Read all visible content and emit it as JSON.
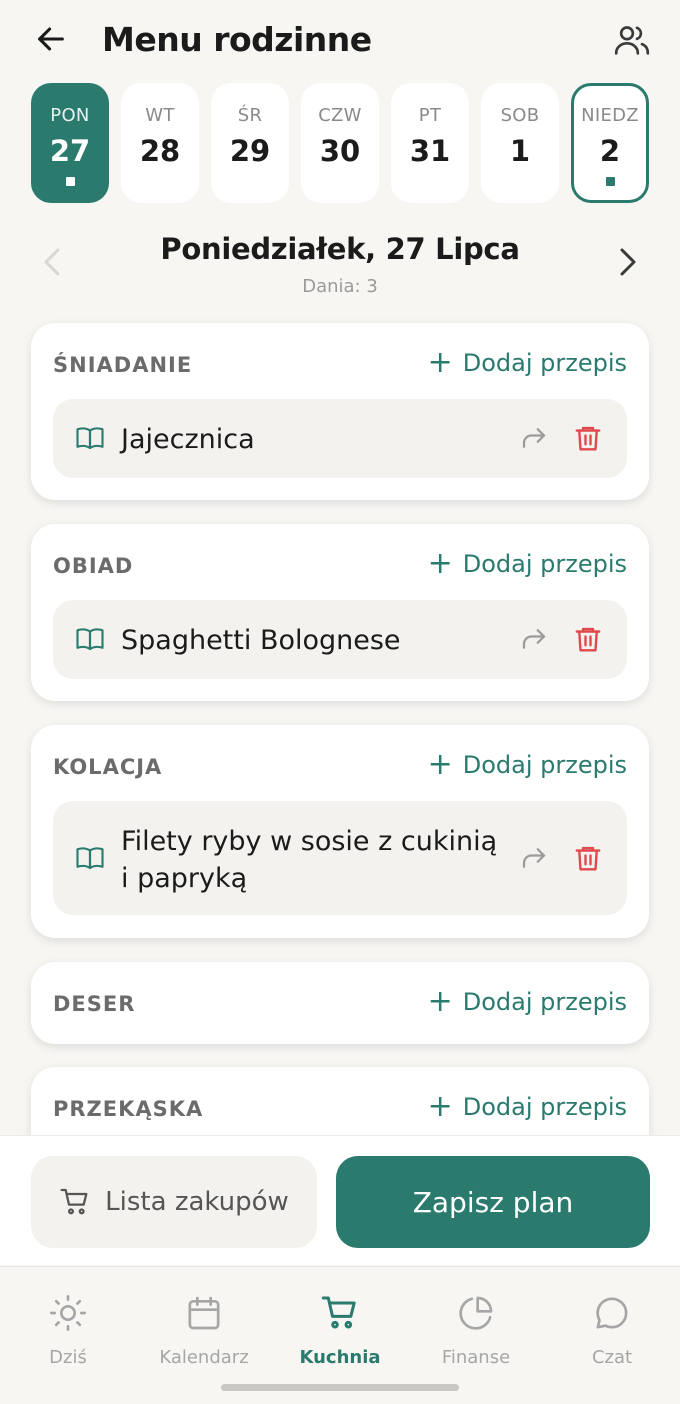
{
  "header": {
    "title": "Menu rodzinne",
    "back_icon": "arrow-left-icon",
    "people_icon": "users-icon"
  },
  "days": [
    {
      "name": "PON",
      "num": "27",
      "state": "active",
      "has_dot": true
    },
    {
      "name": "WT",
      "num": "28",
      "state": "normal",
      "has_dot": false
    },
    {
      "name": "ŚR",
      "num": "29",
      "state": "normal",
      "has_dot": false
    },
    {
      "name": "CZW",
      "num": "30",
      "state": "normal",
      "has_dot": false
    },
    {
      "name": "PT",
      "num": "31",
      "state": "normal",
      "has_dot": false
    },
    {
      "name": "SOB",
      "num": "1",
      "state": "normal",
      "has_dot": false
    },
    {
      "name": "NIEDZ",
      "num": "2",
      "state": "outlined",
      "has_dot": true
    }
  ],
  "date_nav": {
    "title": "Poniedziałek, 27 Lipca",
    "subtitle": "Dania: 3"
  },
  "add_label": "Dodaj przepis",
  "sections": [
    {
      "label": "ŚNIADANIE",
      "meals": [
        {
          "line1": "Jajecznica",
          "line2": ""
        }
      ]
    },
    {
      "label": "OBIAD",
      "meals": [
        {
          "line1": "Spaghetti Bolognese",
          "line2": ""
        }
      ]
    },
    {
      "label": "KOLACJA",
      "meals": [
        {
          "line1": "Filety ryby w sosie z cukinią",
          "line2": "i papryką"
        }
      ]
    },
    {
      "label": "DESER",
      "meals": []
    },
    {
      "label": "PRZEKĄSKA",
      "meals": []
    }
  ],
  "actions": {
    "shopping_label": "Lista zakupów",
    "save_label": "Zapisz plan"
  },
  "tabs": [
    {
      "label": "Dziś",
      "icon": "sun-icon",
      "active": false
    },
    {
      "label": "Kalendarz",
      "icon": "calendar-icon",
      "active": false
    },
    {
      "label": "Kuchnia",
      "icon": "cart-icon",
      "active": true
    },
    {
      "label": "Finanse",
      "icon": "pie-chart-icon",
      "active": false
    },
    {
      "label": "Czat",
      "icon": "chat-icon",
      "active": false
    }
  ],
  "colors": {
    "accent": "#2a7a6e",
    "danger": "#e0484b",
    "background": "#f7f6f3"
  }
}
